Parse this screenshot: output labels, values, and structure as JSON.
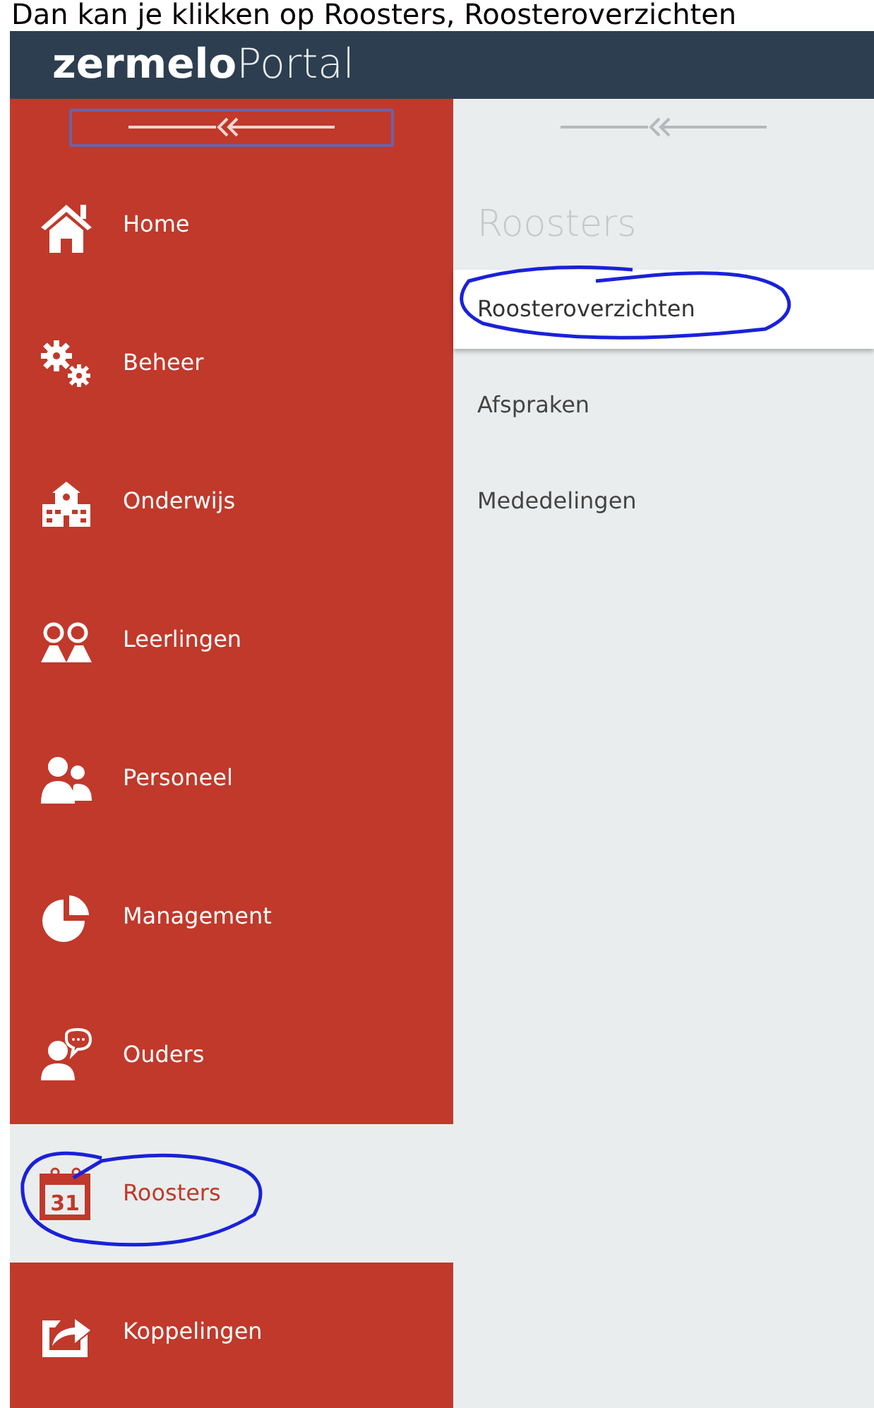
{
  "caption": "Dan kan je klikken op Roosters, Roosteroverzichten",
  "header": {
    "logo_bold": "zermelo",
    "logo_light": "Portal"
  },
  "sidebar": {
    "collapse_focused": true,
    "items": [
      {
        "label": "Home",
        "selected": false
      },
      {
        "label": "Beheer",
        "selected": false
      },
      {
        "label": "Onderwijs",
        "selected": false
      },
      {
        "label": "Leerlingen",
        "selected": false
      },
      {
        "label": "Personeel",
        "selected": false
      },
      {
        "label": "Management",
        "selected": false
      },
      {
        "label": "Ouders",
        "selected": false
      },
      {
        "label": "Roosters",
        "selected": true,
        "icon_text": "31",
        "circled": true
      },
      {
        "label": "Koppelingen",
        "selected": false
      }
    ]
  },
  "submenu": {
    "title": "Roosters",
    "items": [
      {
        "label": "Roosteroverzichten",
        "selected": true,
        "circled": true
      },
      {
        "label": "Afspraken",
        "selected": false
      },
      {
        "label": "Mededelingen",
        "selected": false
      }
    ]
  }
}
